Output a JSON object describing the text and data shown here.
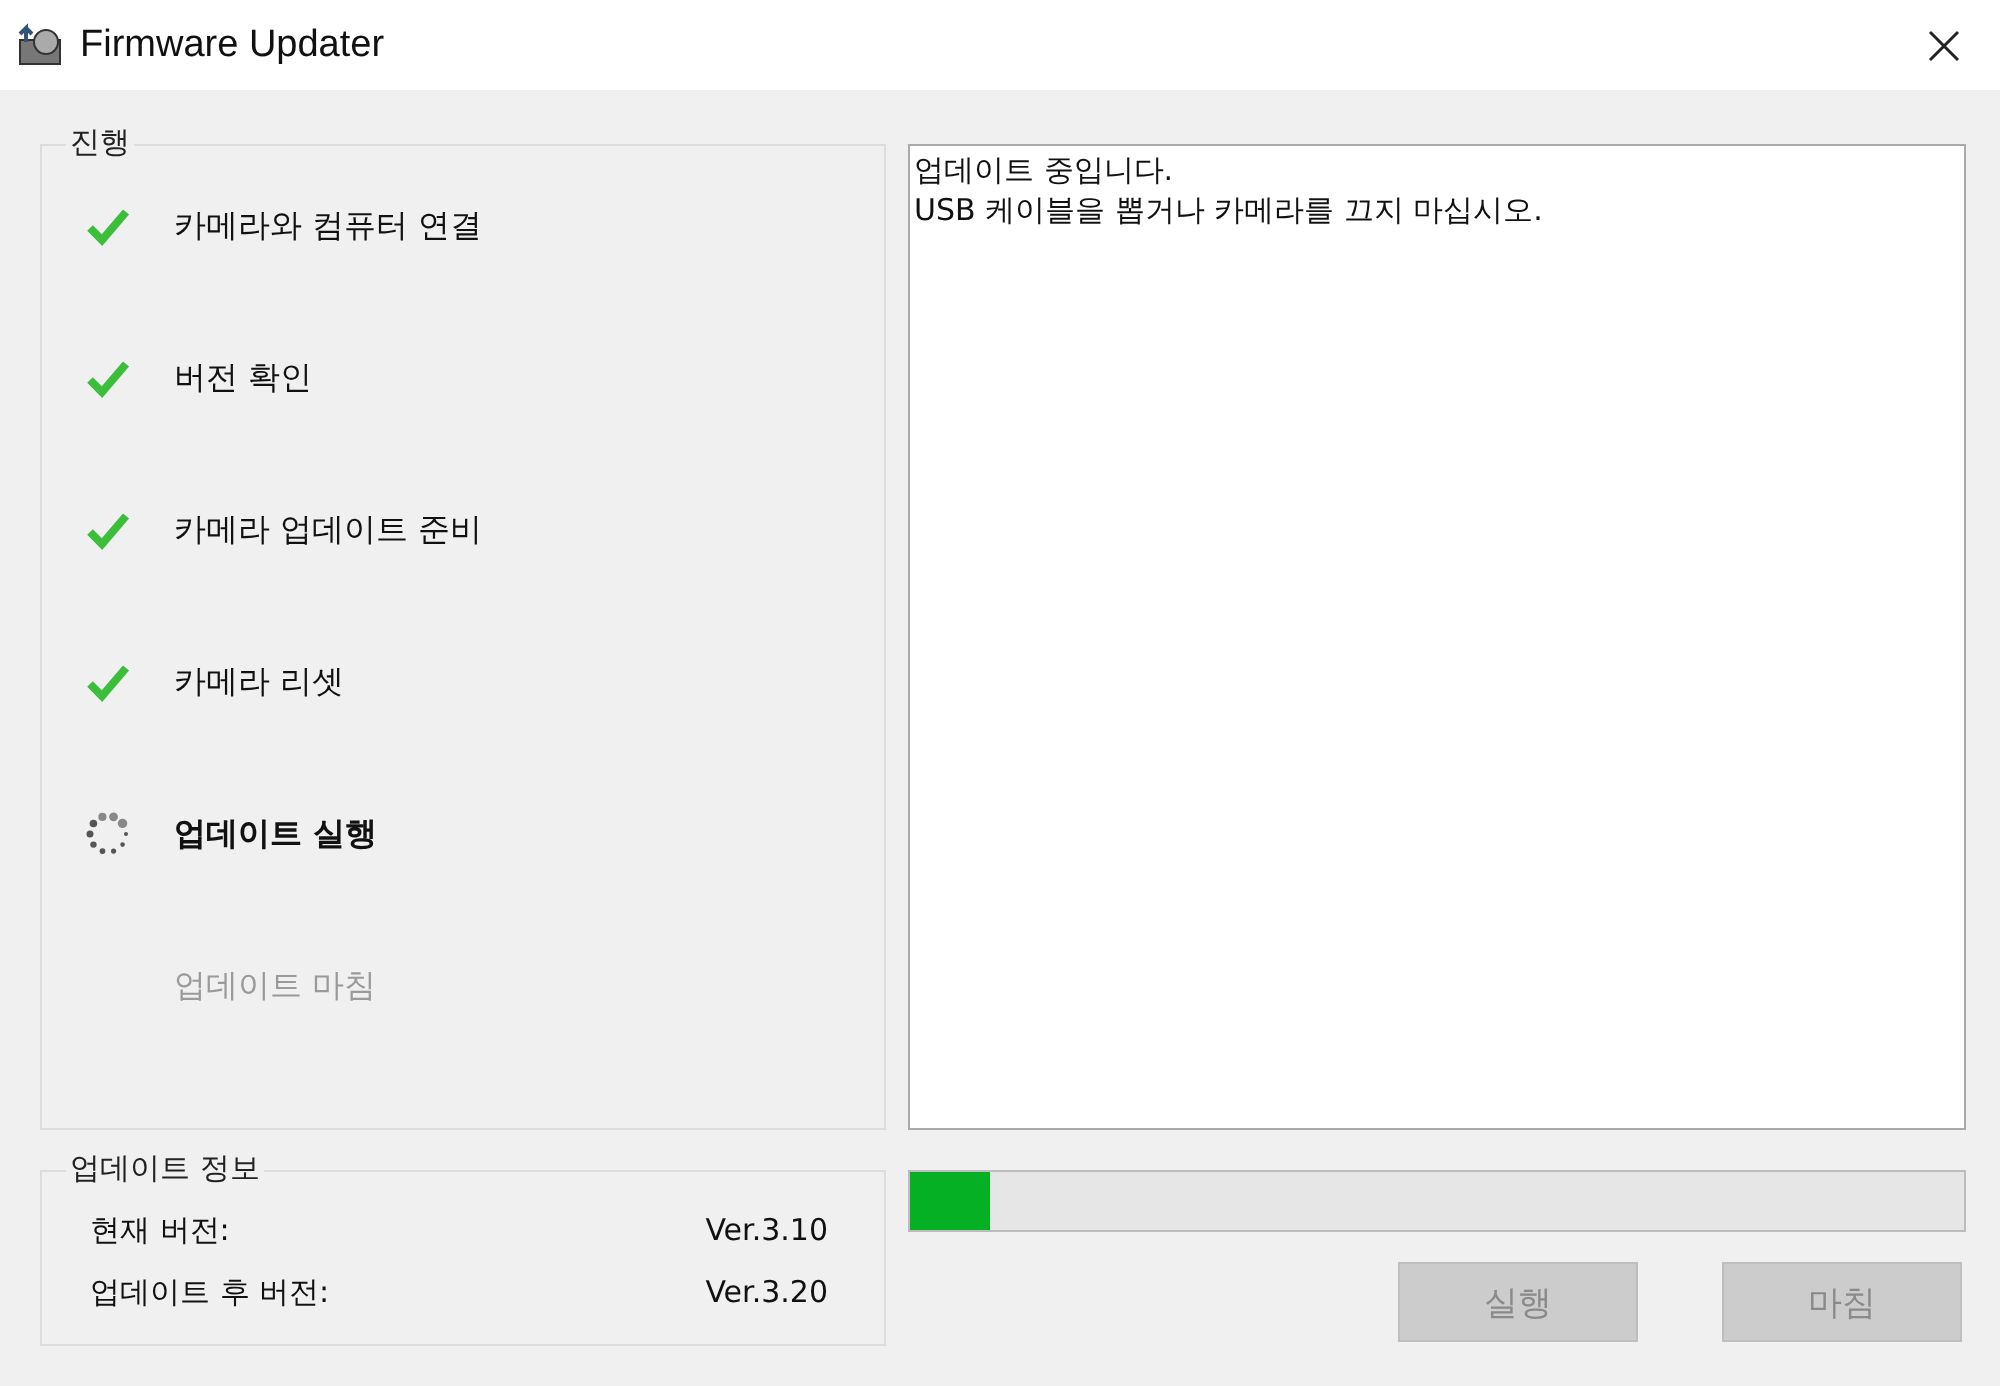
{
  "window": {
    "title": "Firmware Updater"
  },
  "progress_group": {
    "title": "진행",
    "steps": [
      {
        "label": "카메라와 컴퓨터 연결",
        "kind": "done"
      },
      {
        "label": "버전 확인",
        "kind": "done"
      },
      {
        "label": "카메라 업데이트 준비",
        "kind": "done"
      },
      {
        "label": "카메라 리셋",
        "kind": "done"
      },
      {
        "label": "업데이트 실행",
        "kind": "active"
      },
      {
        "label": "업데이트 마침",
        "kind": "pending"
      }
    ]
  },
  "log": {
    "lines": [
      "업데이트 중입니다.",
      "USB 케이블을 뽑거나 카메라를 끄지 마십시오."
    ]
  },
  "info_group": {
    "title": "업데이트 정보",
    "rows": [
      {
        "label": "현재 버전:",
        "value": "Ver.3.10"
      },
      {
        "label": "업데이트 후 버전:",
        "value": "Ver.3.20"
      }
    ]
  },
  "progress": {
    "level": 0.075
  },
  "buttons": [
    {
      "label": "실행",
      "disabled": true
    },
    {
      "label": "마침",
      "disabled": true
    }
  ]
}
